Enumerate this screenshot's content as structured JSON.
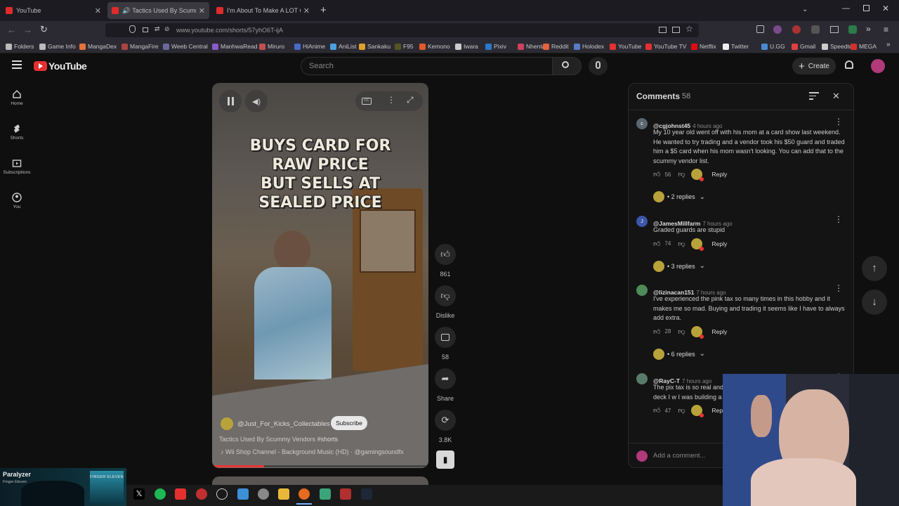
{
  "browser": {
    "tabs": [
      {
        "title": "YouTube"
      },
      {
        "title": "Tactics Used By Scummy Ve"
      },
      {
        "title": "I'm About To Make A LOT Of Pe"
      }
    ],
    "url": "www.youtube.com/shorts/57yhO6T-ijA",
    "bookmarks": [
      "Folders",
      "Game Info",
      "MangaDex",
      "MangaFire",
      "Weeb Central",
      "ManhwaRead",
      "Miruro",
      "HiAnime",
      "AniList",
      "Sankaku",
      "F95",
      "Kemono",
      "Iwara",
      "Pixiv",
      "Nhentai",
      "Reddit",
      "Holodex",
      "YouTube",
      "YouTube TV",
      "Netflix",
      "Twitter",
      "U.GG",
      "Gmail",
      "Speedtest",
      "MEGA"
    ]
  },
  "youtube": {
    "logo": "YouTube",
    "search_placeholder": "Search",
    "create_label": "Create",
    "sidebar": [
      {
        "label": "Home",
        "icon": "home-icon"
      },
      {
        "label": "Shorts",
        "icon": "shorts-icon"
      },
      {
        "label": "Subscriptions",
        "icon": "subscriptions-icon"
      },
      {
        "label": "You",
        "icon": "you-icon"
      }
    ]
  },
  "video": {
    "caption_lines": [
      "BUYS CARD FOR",
      "RAW PRICE",
      "BUT SELLS AT",
      "SEALED PRICE"
    ],
    "channel": "@Just_For_Kicks_Collectables",
    "subscribe": "Subscribe",
    "title": "Tactics Used By Scummy Vendors",
    "hashtag": "#shorts",
    "music": "Wii Shop Channel - Background Music (HD) · @gamingsoundfx",
    "likes": "861",
    "dislike_label": "Dislike",
    "comments_count": "58",
    "share_label": "Share",
    "remix_count": "3.8K"
  },
  "comments": {
    "title": "Comments",
    "count": "58",
    "add_placeholder": "Add a comment...",
    "items": [
      {
        "author": "@cgjohnst45",
        "time": "4 hours ago",
        "text": "My 10 year old went off with his mom at a card show last weekend. He wanted to try trading and a vendor took his $50 guard and traded him a $5 card when his mom wasn't looking. You can add that to the scummy vendor list.",
        "likes": "56",
        "reply": "Reply",
        "replies": "• 2 replies",
        "avatar": "c",
        "avatar_color": "#5a6670"
      },
      {
        "author": "@JamesMillfarm",
        "time": "7 hours ago",
        "text": "Graded guards are stupid",
        "likes": "74",
        "reply": "Reply",
        "replies": "• 3 replies",
        "avatar": "J",
        "avatar_color": "#3a57a8"
      },
      {
        "author": "@lizinacan151",
        "time": "7 hours ago",
        "text": "I've experienced the pink tax so many times in this hobby and it makes me so mad. Buying and trading it seems like I have to always add extra.",
        "likes": "28",
        "reply": "Reply",
        "replies": "• 6 replies",
        "avatar": "",
        "avatar_color": "#4f8a5a"
      },
      {
        "author": "@RayC-T",
        "time": "7 hours ago",
        "text": "The pix tax is so real and little girl went to buy a s go buy one for a deck I w I was building a deck bu",
        "likes": "47",
        "reply": "Rep",
        "replies": "",
        "avatar": "",
        "avatar_color": "#5a7a6a"
      }
    ]
  },
  "spotify": {
    "song": "Paralyzer",
    "artist": "Finger Eleven",
    "album_label": "FINGER ELEVEN"
  }
}
